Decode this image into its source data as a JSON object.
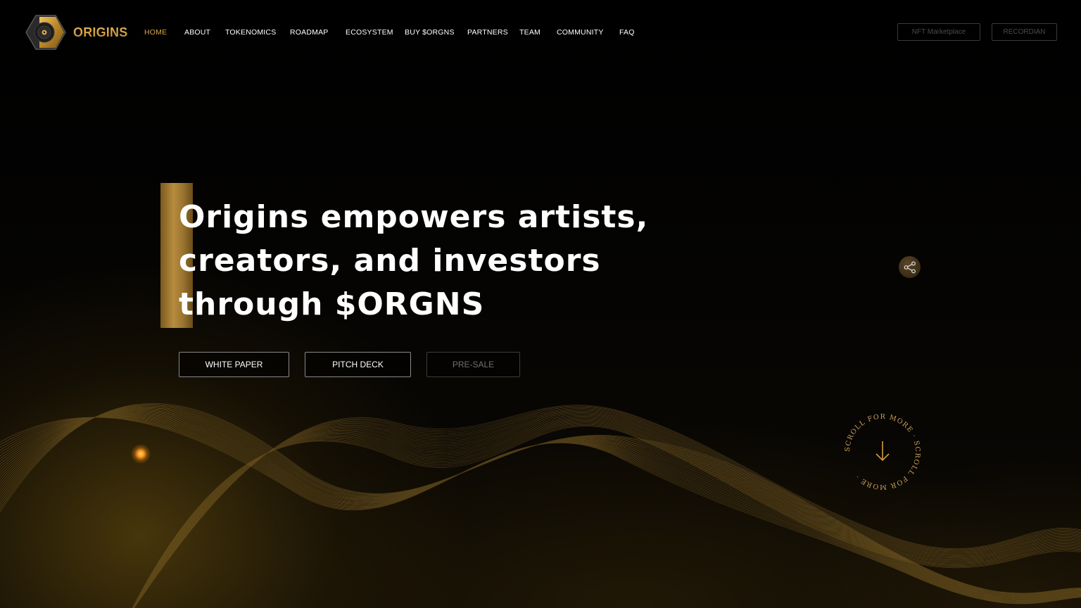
{
  "brand": {
    "name": "ORIGINS"
  },
  "nav": {
    "items": [
      {
        "label": "HOME",
        "active": true
      },
      {
        "label": "ABOUT"
      },
      {
        "label": "TOKENOMICS"
      },
      {
        "label": "ROADMAP"
      },
      {
        "label": "ECOSYSTEM"
      },
      {
        "label": "BUY $ORGNS"
      },
      {
        "label": "PARTNERS"
      },
      {
        "label": "TEAM"
      },
      {
        "label": "COMMUNITY"
      },
      {
        "label": "FAQ"
      }
    ]
  },
  "header_buttons": {
    "nft_marketplace": "NFT Marketplace",
    "recordian": "RECORDIAN"
  },
  "hero": {
    "title_line1": "Origins empowers artists,",
    "title_line2": "creators, and investors",
    "title_line3": "through $ORGNS",
    "buttons": {
      "white_paper": "WHITE PAPER",
      "pitch_deck": "PITCH DECK",
      "pre_sale": "PRE-SALE"
    }
  },
  "scroll_indicator": {
    "text": "SCROLL FOR MORE · SCROLL FOR MORE · "
  },
  "icons": {
    "share": "share-icon",
    "scroll": "arrow-down-icon",
    "logo": "hexagon-record-logo-icon"
  },
  "colors": {
    "accent_gold": "#d7a84a",
    "brand_gold": "#c8962e",
    "background": "#000000"
  }
}
